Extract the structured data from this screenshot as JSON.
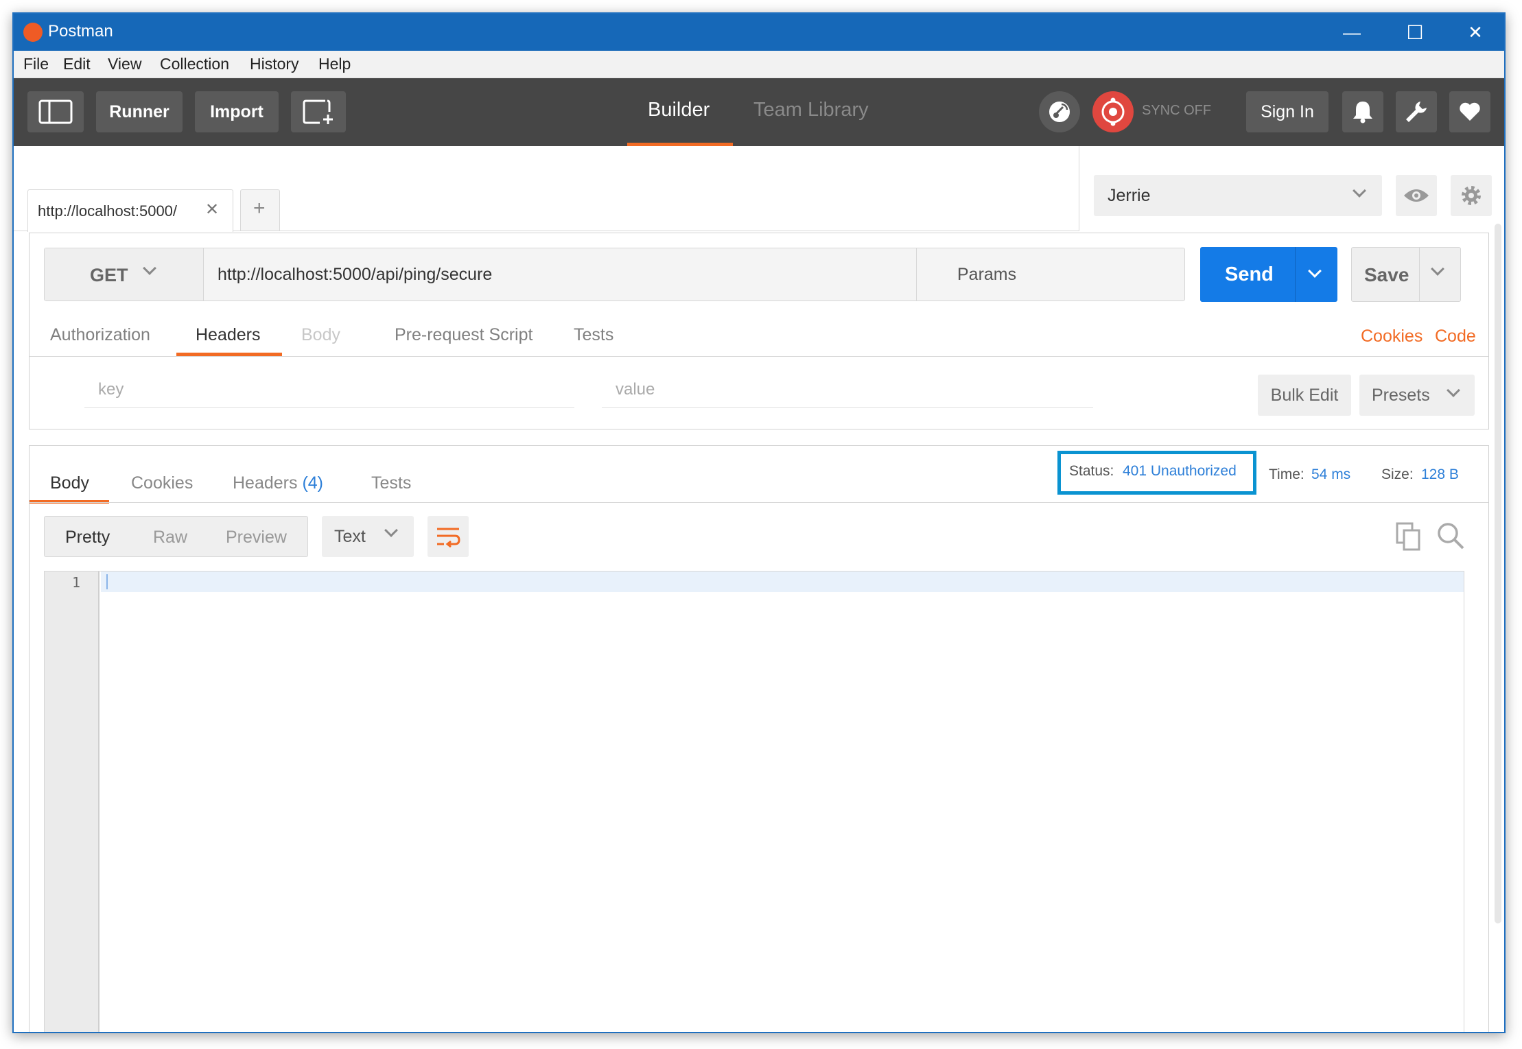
{
  "window": {
    "title": "Postman",
    "controls": {
      "minimize": "—",
      "maximize": "☐",
      "close": "✕"
    }
  },
  "menu": [
    "File",
    "Edit",
    "View",
    "Collection",
    "History",
    "Help"
  ],
  "toolbar": {
    "runner": "Runner",
    "import": "Import",
    "tabs": {
      "builder": "Builder",
      "team_library": "Team Library"
    },
    "sync": "SYNC OFF",
    "sign_in": "Sign In"
  },
  "request_tabs": {
    "active_label": "http://localhost:5000/",
    "close_glyph": "✕",
    "new_glyph": "+"
  },
  "environment": {
    "selected": "Jerrie"
  },
  "request": {
    "method": "GET",
    "url": "http://localhost:5000/api/ping/secure",
    "params": "Params",
    "send": "Send",
    "save": "Save",
    "tabs": [
      "Authorization",
      "Headers",
      "Body",
      "Pre-request Script",
      "Tests"
    ],
    "links": {
      "cookies": "Cookies",
      "code": "Code"
    },
    "headers": {
      "key_placeholder": "key",
      "value_placeholder": "value",
      "bulk_edit": "Bulk Edit",
      "presets": "Presets"
    }
  },
  "response": {
    "tabs": {
      "body": "Body",
      "cookies": "Cookies",
      "headers": "Headers",
      "headers_count": "(4)",
      "tests": "Tests"
    },
    "status_label": "Status:",
    "status_value": "401 Unauthorized",
    "time_label": "Time:",
    "time_value": "54 ms",
    "size_label": "Size:",
    "size_value": "128 B",
    "view_modes": [
      "Pretty",
      "Raw",
      "Preview"
    ],
    "format": "Text",
    "line_number": "1"
  },
  "colors": {
    "titlebar": "#1668b8",
    "toolbar": "#464646",
    "accent_orange": "#f26b24",
    "send_blue": "#147be7",
    "link_blue": "#2d7fd8",
    "status_highlight": "#0a93d1"
  }
}
